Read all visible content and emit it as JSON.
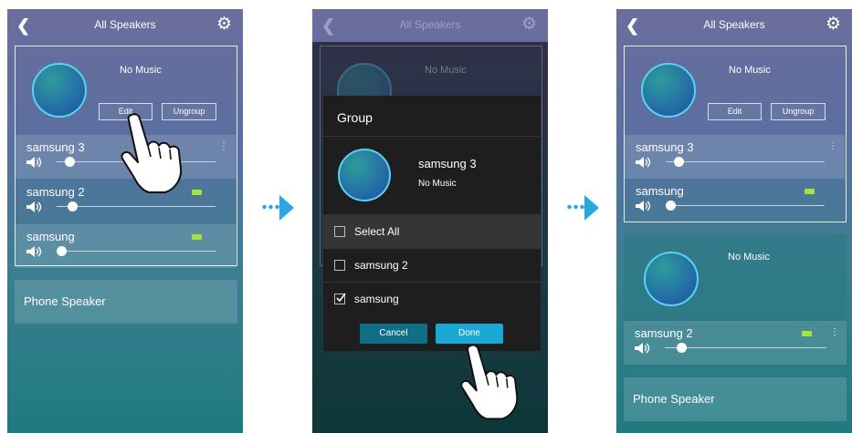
{
  "screen1": {
    "title": "All Speakers",
    "group": {
      "status": "No Music",
      "edit_label": "Edit",
      "ungroup_label": "Ungroup",
      "speakers": [
        {
          "name": "samsung 3",
          "volume": 0.08,
          "battery": false,
          "more": true
        },
        {
          "name": "samsung 2",
          "volume": 0.1,
          "battery": true,
          "more": false
        },
        {
          "name": "samsung",
          "volume": 0.03,
          "battery": true,
          "more": false
        }
      ]
    },
    "phone_speaker": "Phone Speaker"
  },
  "screen2": {
    "title": "All Speakers",
    "background_status": "No Music",
    "dialog": {
      "title": "Group",
      "speaker_name": "samsung 3",
      "speaker_status": "No Music",
      "options": [
        {
          "label": "Select All",
          "checked": false,
          "highlighted": true
        },
        {
          "label": "samsung 2",
          "checked": false,
          "highlighted": false
        },
        {
          "label": "samsung",
          "checked": true,
          "highlighted": false
        }
      ],
      "cancel_label": "Cancel",
      "done_label": "Done"
    }
  },
  "screen3": {
    "title": "All Speakers",
    "group": {
      "status": "No Music",
      "edit_label": "Edit",
      "ungroup_label": "Ungroup",
      "speakers": [
        {
          "name": "samsung 3",
          "volume": 0.08,
          "battery": false,
          "more": true
        },
        {
          "name": "samsung",
          "volume": 0.03,
          "battery": true,
          "more": false
        }
      ]
    },
    "single": {
      "status": "No Music",
      "speaker": {
        "name": "samsung 2",
        "volume": 0.1,
        "battery": true,
        "more": true
      }
    },
    "phone_speaker": "Phone Speaker"
  },
  "colors": {
    "accent": "#29a8e0",
    "done_button": "#1aa9d6",
    "cancel_button": "#0f6f86",
    "battery": "#a8e33c"
  },
  "icons": [
    "back-arrow-icon",
    "gear-icon",
    "speaker-volume-icon",
    "battery-icon",
    "more-vertical-icon",
    "checkbox-icon",
    "pointing-hand-icon",
    "arrow-right-icon"
  ]
}
